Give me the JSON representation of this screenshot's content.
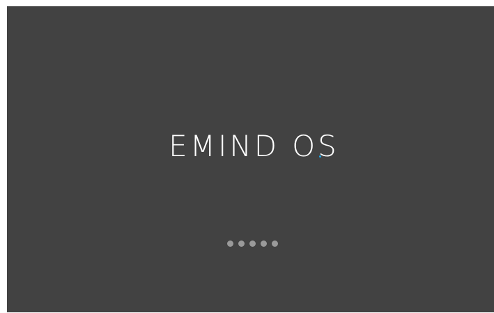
{
  "boot": {
    "logo_part1": "EMIND",
    "logo_part2_a": "O",
    "logo_part2_b": "S",
    "accent_color": "#1ea7e8",
    "background_color": "#424242",
    "loading_dot_color": "#9a9a9a",
    "loading_dots": 5
  }
}
